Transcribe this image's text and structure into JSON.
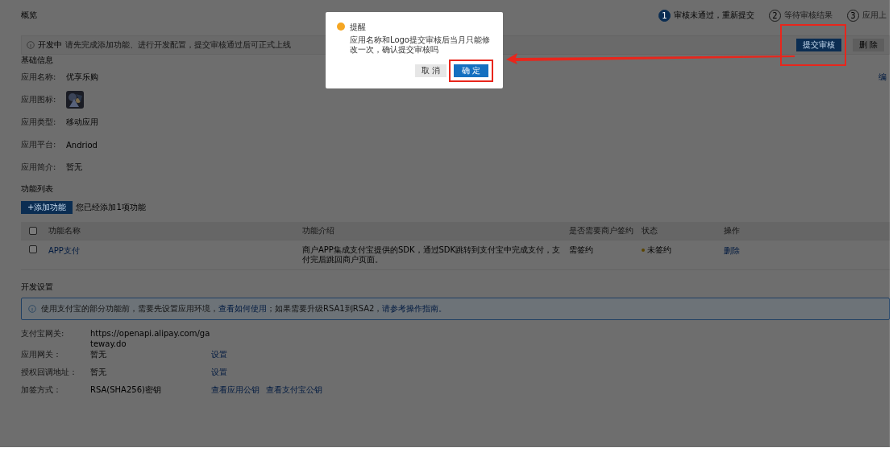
{
  "page_title": "概览",
  "steps": [
    {
      "number": "1",
      "label": "审核未通过，重新提交",
      "selected": true
    },
    {
      "number": "2",
      "label": "等待审核结果",
      "selected": false
    },
    {
      "number": "3",
      "label": "应用上",
      "selected": false
    }
  ],
  "status_bar": {
    "status": "开发中",
    "message": "请先完成添加功能、进行开发配置，提交审核通过后可正式上线",
    "submit": "提交审核",
    "delete": "删 除"
  },
  "basic_info": {
    "title": "基础信息",
    "edit_link": "编",
    "fields": [
      {
        "kind": "text",
        "label": "应用名称:",
        "value": "优享乐购"
      },
      {
        "kind": "picture",
        "label": "应用图标:"
      },
      {
        "kind": "text",
        "label": "应用类型:",
        "value": "移动应用"
      },
      {
        "kind": "text",
        "label": "应用平台:",
        "value": "Andriod"
      },
      {
        "kind": "text",
        "label": "应用简介:",
        "value": "暂无"
      }
    ]
  },
  "features": {
    "title": "功能列表",
    "select_all_checked": false,
    "add_button": "+添加功能",
    "count_note": "您已经添加1项功能",
    "columns": [
      "功能名称",
      "功能介绍",
      "是否需要商户签约",
      "状态",
      "操作"
    ],
    "rows": [
      {
        "checked": false,
        "name": "APP支付",
        "description": "商户APP集成支付宝提供的SDK，通过SDK跳转到支付宝中完成支付，支付完后跳回商户页面。",
        "signing": "需签约",
        "status": "未签约",
        "action": "删除"
      }
    ]
  },
  "dev_settings": {
    "title": "开发设置",
    "notice": [
      {
        "kind": "text",
        "text": "使用支付宝的部分功能前，需要先设置应用环境，"
      },
      {
        "kind": "link",
        "text": "查看如何使用"
      },
      {
        "kind": "text",
        "text": "；如果需要升级RSA1到RSA2，"
      },
      {
        "kind": "link",
        "text": "请参考操作指南。"
      }
    ],
    "fields": [
      {
        "label": "支付宝网关:",
        "value": "https://openapi.alipay.com/gateway.do"
      },
      {
        "label": "应用网关：",
        "value": "暂无",
        "links": [
          "设置"
        ]
      },
      {
        "label": "授权回调地址：",
        "value": "暂无",
        "links": [
          "设置"
        ]
      },
      {
        "label": "加签方式：",
        "value": "RSA(SHA256)密钥",
        "links": [
          "查看应用公钥",
          "查看支付宝公钥"
        ]
      }
    ]
  },
  "dialog": {
    "title": "提醒",
    "message": "应用名称和Logo提交审核后当月只能修改一次，确认提交审核吗",
    "cancel": "取 消",
    "confirm": "确 定"
  }
}
